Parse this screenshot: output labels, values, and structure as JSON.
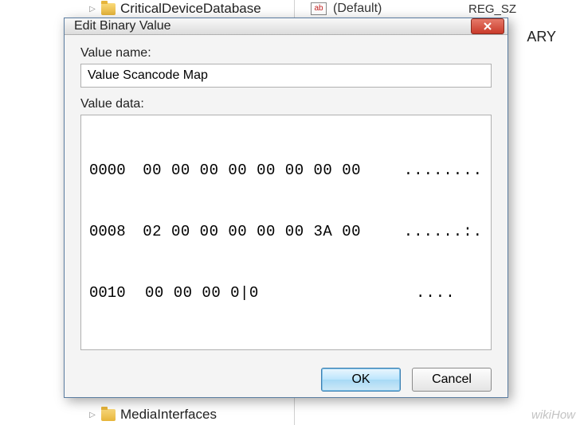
{
  "background": {
    "tree_items": {
      "top": "CriticalDeviceDatabase",
      "bottom": "MediaInterfaces"
    },
    "value_row": {
      "icon_text": "ab",
      "name": "(Default)",
      "type": "REG_SZ"
    },
    "cut_label": "ARY"
  },
  "dialog": {
    "title": "Edit Binary Value",
    "labels": {
      "value_name": "Value name:",
      "value_data": "Value data:"
    },
    "value_name": "Value Scancode Map",
    "hex_rows": [
      {
        "offset": "0000",
        "bytes": "00 00 00 00 00 00 00 00",
        "ascii": "........"
      },
      {
        "offset": "0008",
        "bytes": "02 00 00 00 00 00 3A 00",
        "ascii": "......:."
      },
      {
        "offset": "0010",
        "bytes": "00 00 00 0|0",
        "ascii": "...."
      }
    ],
    "buttons": {
      "ok": "OK",
      "cancel": "Cancel"
    }
  },
  "watermark": "wikiHow"
}
